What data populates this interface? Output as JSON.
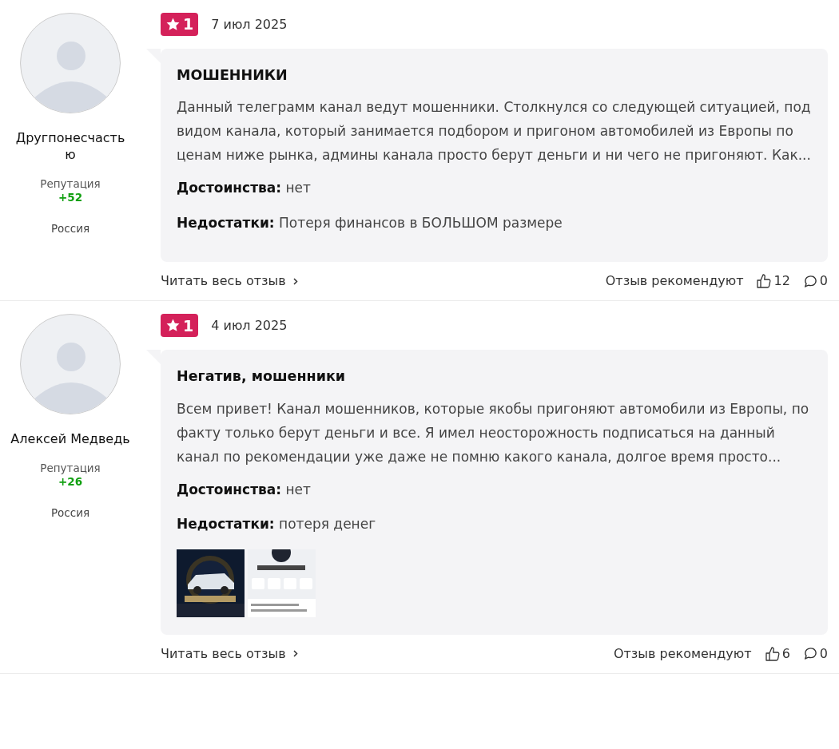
{
  "reviews": [
    {
      "author": "Другпонесчасть ю",
      "reputation_label": "Репутация",
      "reputation": "+52",
      "country": "Россия",
      "rating": "1",
      "date": "7 июл 2025",
      "title": "МОШЕННИКИ",
      "text": "Данный телеграмм канал ведут мошенники. Столкнулся со следующей ситуацией, под видом канала, который занимается подбором и пригоном автомобилей из Европы по ценам ниже рынка, админы канала просто берут деньги и ни чего не пригоняют. Как...",
      "pros_label": "Достоинства:",
      "pros": "нет",
      "cons_label": "Недостатки:",
      "cons": "Потеря финансов в БОЛЬШОМ размере",
      "read_more": "Читать весь отзыв",
      "recommend_label": "Отзыв рекомендуют",
      "likes": "12",
      "comments": "0"
    },
    {
      "author": "Алексей Медведь",
      "reputation_label": "Репутация",
      "reputation": "+26",
      "country": "Россия",
      "rating": "1",
      "date": "4 июл 2025",
      "title": "Негатив, мошенники",
      "text": "Всем привет! Канал мошенников, которые якобы пригоняют автомобили из Европы, по факту только берут деньги и все. Я имел неосторожность подписаться на данный канал по рекомендации уже даже не помню какого канала, долгое время просто...",
      "pros_label": "Достоинства:",
      "pros": "нет",
      "cons_label": "Недостатки:",
      "cons": "потеря денег",
      "read_more": "Читать весь отзыв",
      "recommend_label": "Отзыв рекомендуют",
      "likes": "6",
      "comments": "0"
    }
  ]
}
